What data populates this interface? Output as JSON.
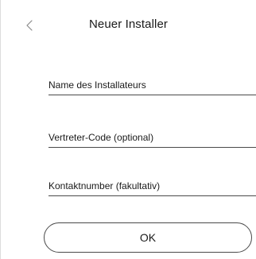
{
  "header": {
    "title": "Neuer Installer",
    "back_icon": "chevron-left-icon"
  },
  "form": {
    "installer_name": {
      "placeholder": "Name des Installateurs",
      "value": ""
    },
    "agent_code": {
      "placeholder": "Vertreter-Code (optional)",
      "value": ""
    },
    "contact_number": {
      "placeholder": "Kontaktnumber (fakultativ)",
      "value": ""
    }
  },
  "actions": {
    "ok_label": "OK"
  }
}
